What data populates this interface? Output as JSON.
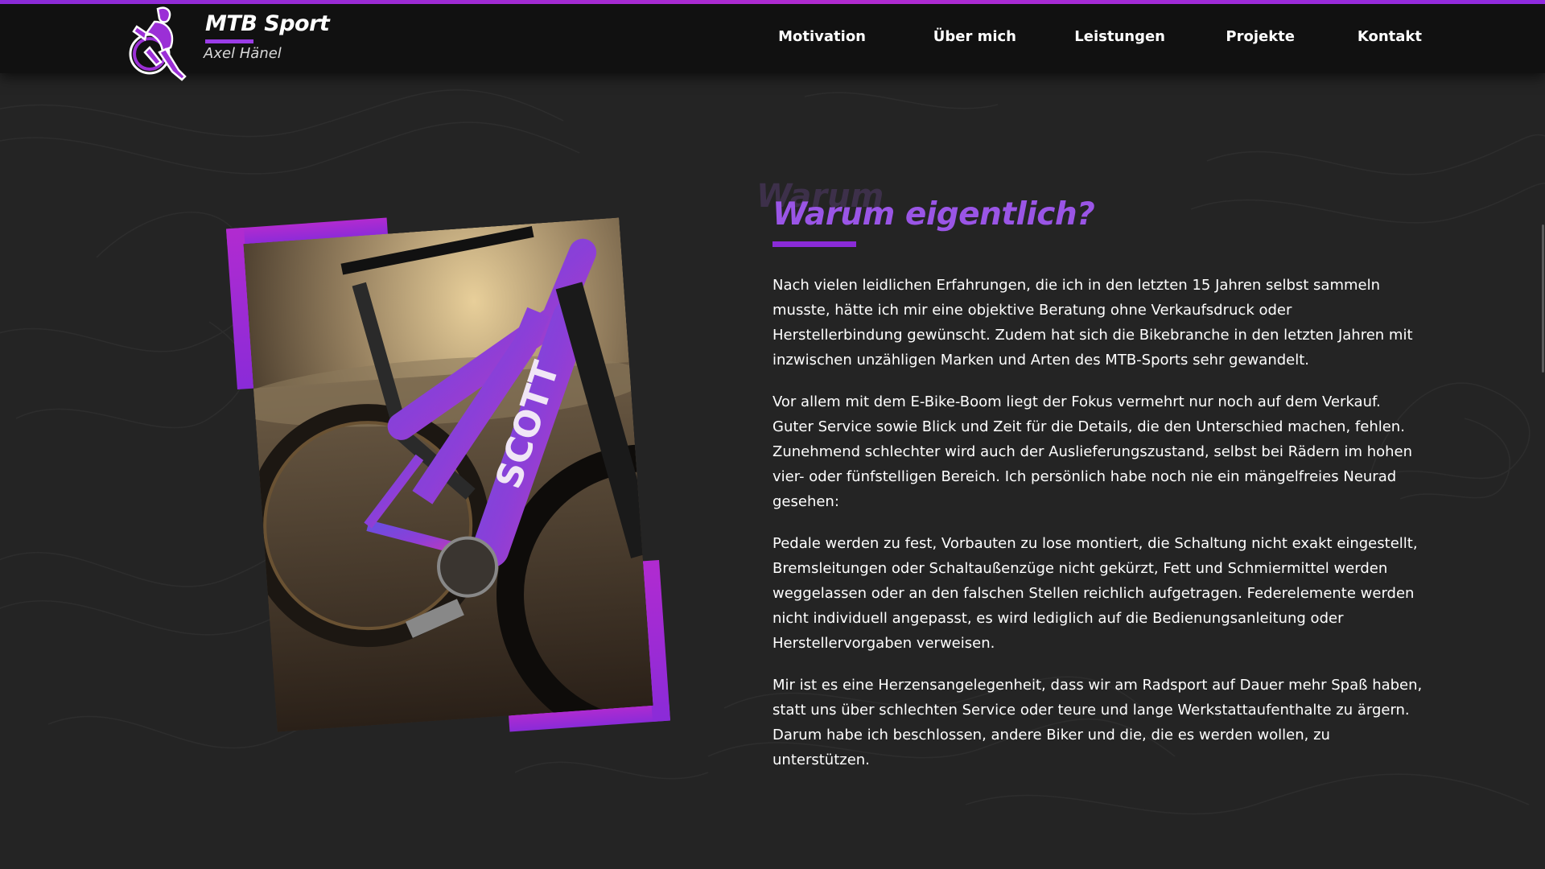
{
  "brand": {
    "title": "MTB Sport",
    "subtitle": "Axel Hänel",
    "logo_icon": "mountain-biker-logo"
  },
  "nav": {
    "items": [
      {
        "label": "Motivation"
      },
      {
        "label": "Über mich"
      },
      {
        "label": "Leistungen"
      },
      {
        "label": "Projekte"
      },
      {
        "label": "Kontakt"
      }
    ]
  },
  "section": {
    "heading": "Warum eigentlich?",
    "heading_ghost": "Warum",
    "photo_brand_text": "SCOTT",
    "paragraphs": [
      "Nach vielen leidlichen Erfahrungen, die ich in den letzten 15 Jahren selbst sammeln musste, hätte ich mir eine objektive Beratung ohne Verkaufsdruck oder Herstellerbindung gewünscht. Zudem hat sich die Bikebranche in den letzten Jahren mit inzwischen unzähligen Marken und Arten des MTB-Sports sehr gewandelt.",
      "Vor allem mit dem E-Bike-Boom liegt der Fokus vermehrt nur noch auf dem Verkauf. Guter Service sowie Blick und Zeit für die Details, die den Unterschied machen, fehlen. Zunehmend schlechter wird auch der Auslieferungszustand, selbst bei Rädern im hohen vier- oder fünfstelligen Bereich. Ich persönlich habe noch nie ein mängelfreies Neurad gesehen:",
      "Pedale werden zu fest, Vorbauten zu lose montiert, die Schaltung nicht exakt eingestellt, Bremsleitungen oder Schaltaußenzüge nicht gekürzt, Fett und Schmiermittel werden weggelassen oder an den falschen Stellen reichlich aufgetragen. Federelemente werden nicht individuell angepasst, es wird lediglich auf die Bedienungsanleitung oder Herstellervorgaben verweisen.",
      "Mir ist es eine Herzensangelegenheit, dass wir am Radsport auf Dauer mehr Spaß haben, statt uns über schlechten Service oder teure und lange Werkstattaufenthalte zu ärgern. Darum habe ich beschlossen, andere Biker und die, die es werden wollen, zu unterstützen."
    ]
  },
  "colors": {
    "accent": "#8a2bd8",
    "accent_light": "#9a55e6",
    "magenta": "#b12bd0",
    "header_bg": "#111111",
    "page_bg": "#242424"
  }
}
